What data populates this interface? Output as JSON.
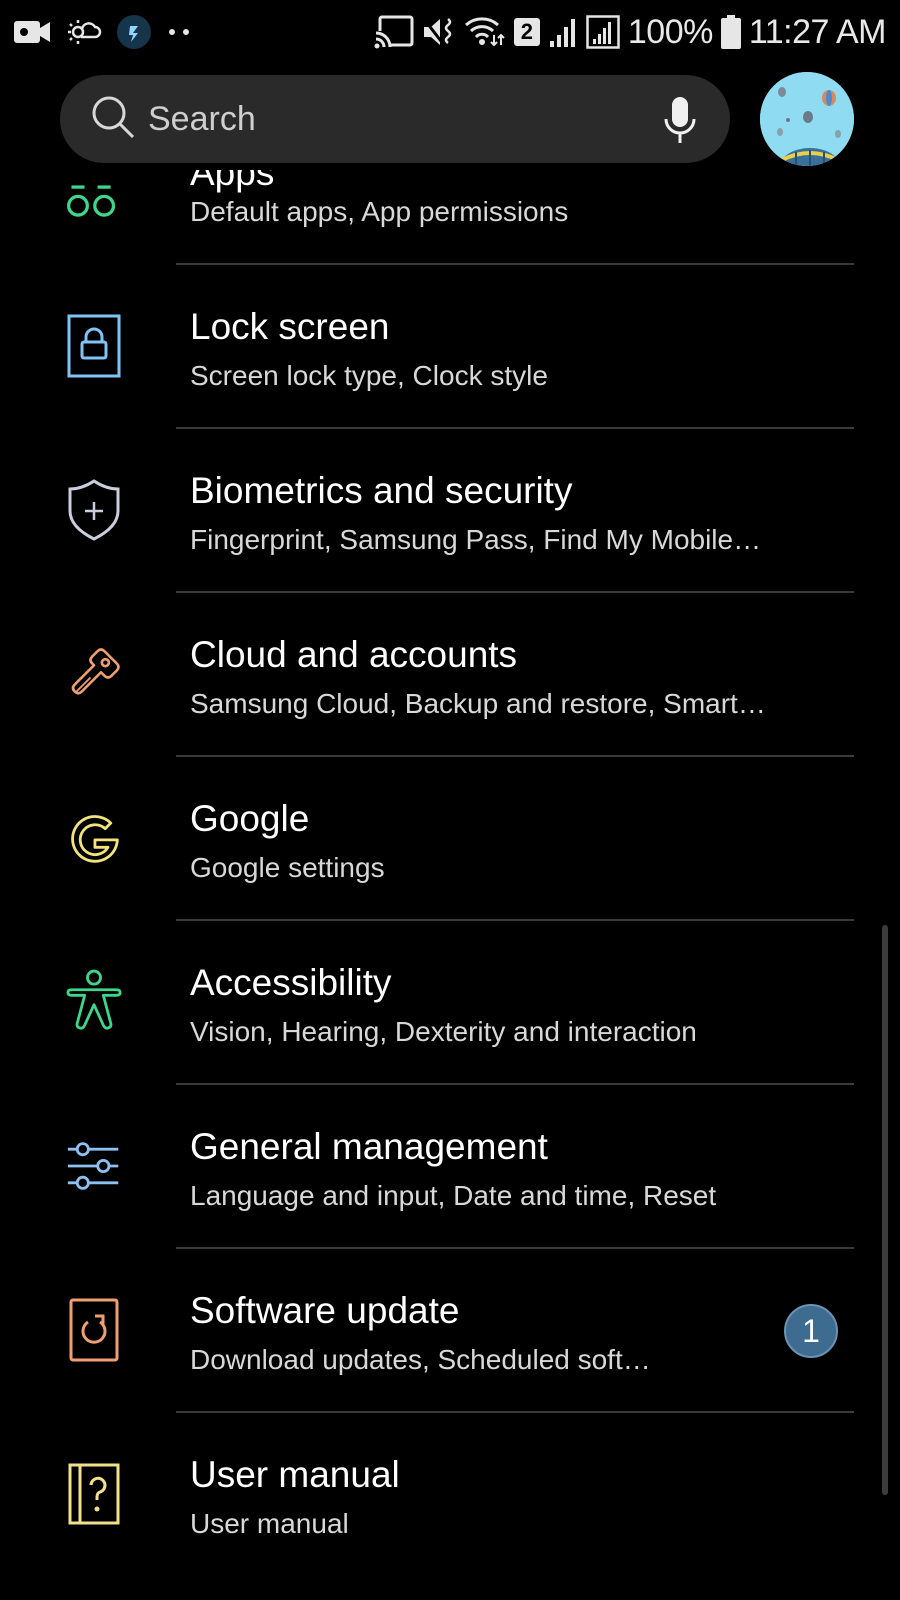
{
  "status_bar": {
    "battery_percent": "100%",
    "time": "11:27 AM",
    "sim_badge": "2",
    "left_icons": [
      "video-camera-icon",
      "weather-icon",
      "power-saving-icon",
      "more-dots-icon"
    ],
    "right_icons": [
      "cast-icon",
      "vibrate-mute-icon",
      "wifi-icon",
      "sim-badge",
      "signal-icon",
      "signal-boxed-icon",
      "battery-icon"
    ]
  },
  "header": {
    "search_placeholder": "Search",
    "mic_icon": "microphone-icon",
    "avatar_label": "profile-avatar"
  },
  "settings": {
    "items": [
      {
        "title": "Apps",
        "subtitle": "Default apps, App permissions",
        "icon": "apps-icon",
        "color": "#3dd68c"
      },
      {
        "title": "Lock screen",
        "subtitle": "Screen lock type, Clock style",
        "icon": "lock-screen-icon",
        "color": "#7fc4f5"
      },
      {
        "title": "Biometrics and security",
        "subtitle": "Fingerprint, Samsung Pass, Find My Mobile…",
        "icon": "shield-icon",
        "color": "#c9cfdc"
      },
      {
        "title": "Cloud and accounts",
        "subtitle": "Samsung Cloud, Backup and restore, Smart…",
        "icon": "key-icon",
        "color": "#f0a070"
      },
      {
        "title": "Google",
        "subtitle": "Google settings",
        "icon": "google-icon",
        "color": "#f2e37a"
      },
      {
        "title": "Accessibility",
        "subtitle": "Vision, Hearing, Dexterity and interaction",
        "icon": "accessibility-icon",
        "color": "#3dd68c"
      },
      {
        "title": "General management",
        "subtitle": "Language and input, Date and time, Reset",
        "icon": "sliders-icon",
        "color": "#8cc0f0"
      },
      {
        "title": "Software update",
        "subtitle": "Download updates, Scheduled soft…",
        "icon": "software-update-icon",
        "color": "#f0a070",
        "badge": "1"
      },
      {
        "title": "User manual",
        "subtitle": "User manual",
        "icon": "user-manual-icon",
        "color": "#f2e08a"
      }
    ]
  }
}
